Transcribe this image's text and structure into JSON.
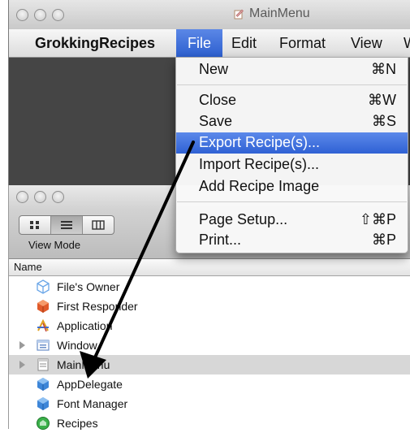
{
  "back_window": {
    "title": "MainMenu",
    "menubar": {
      "app_name": "GrokkingRecipes",
      "items": [
        "File",
        "Edit",
        "Format",
        "View",
        "W"
      ]
    }
  },
  "file_menu": {
    "groups": [
      [
        {
          "label": "New",
          "shortcut": "⌘N"
        }
      ],
      [
        {
          "label": "Close",
          "shortcut": "⌘W"
        },
        {
          "label": "Save",
          "shortcut": "⌘S"
        },
        {
          "label": "Export Recipe(s)...",
          "shortcut": "",
          "highlighted": true
        },
        {
          "label": "Import Recipe(s)...",
          "shortcut": ""
        },
        {
          "label": "Add Recipe Image",
          "shortcut": ""
        }
      ],
      [
        {
          "label": "Page Setup...",
          "shortcut": "⇧⌘P"
        },
        {
          "label": "Print...",
          "shortcut": "⌘P"
        }
      ]
    ]
  },
  "doc_window": {
    "toolbar": {
      "view_mode_label": "View Mode",
      "segments": [
        "icon-view-icon",
        "list-view-icon",
        "column-view-icon"
      ],
      "selected_segment": "list-view-icon"
    },
    "column_header": "Name",
    "rows": [
      {
        "label": "File's Owner",
        "icon": "files-owner-cube-icon"
      },
      {
        "label": "First Responder",
        "icon": "first-responder-cube-icon"
      },
      {
        "label": "Application",
        "icon": "application-icon"
      },
      {
        "label": "Window",
        "icon": "window-icon",
        "expandable": true
      },
      {
        "label": "MainMenu",
        "icon": "menu-icon",
        "expandable": true,
        "selected": true
      },
      {
        "label": "AppDelegate",
        "icon": "object-cube-icon"
      },
      {
        "label": "Font Manager",
        "icon": "object-cube-icon"
      },
      {
        "label": "Recipes",
        "icon": "array-controller-icon"
      }
    ]
  },
  "colors": {
    "menu_highlight": "#3a6bdc",
    "canvas_dark": "#454545",
    "selected_row": "#d7d7d7"
  }
}
